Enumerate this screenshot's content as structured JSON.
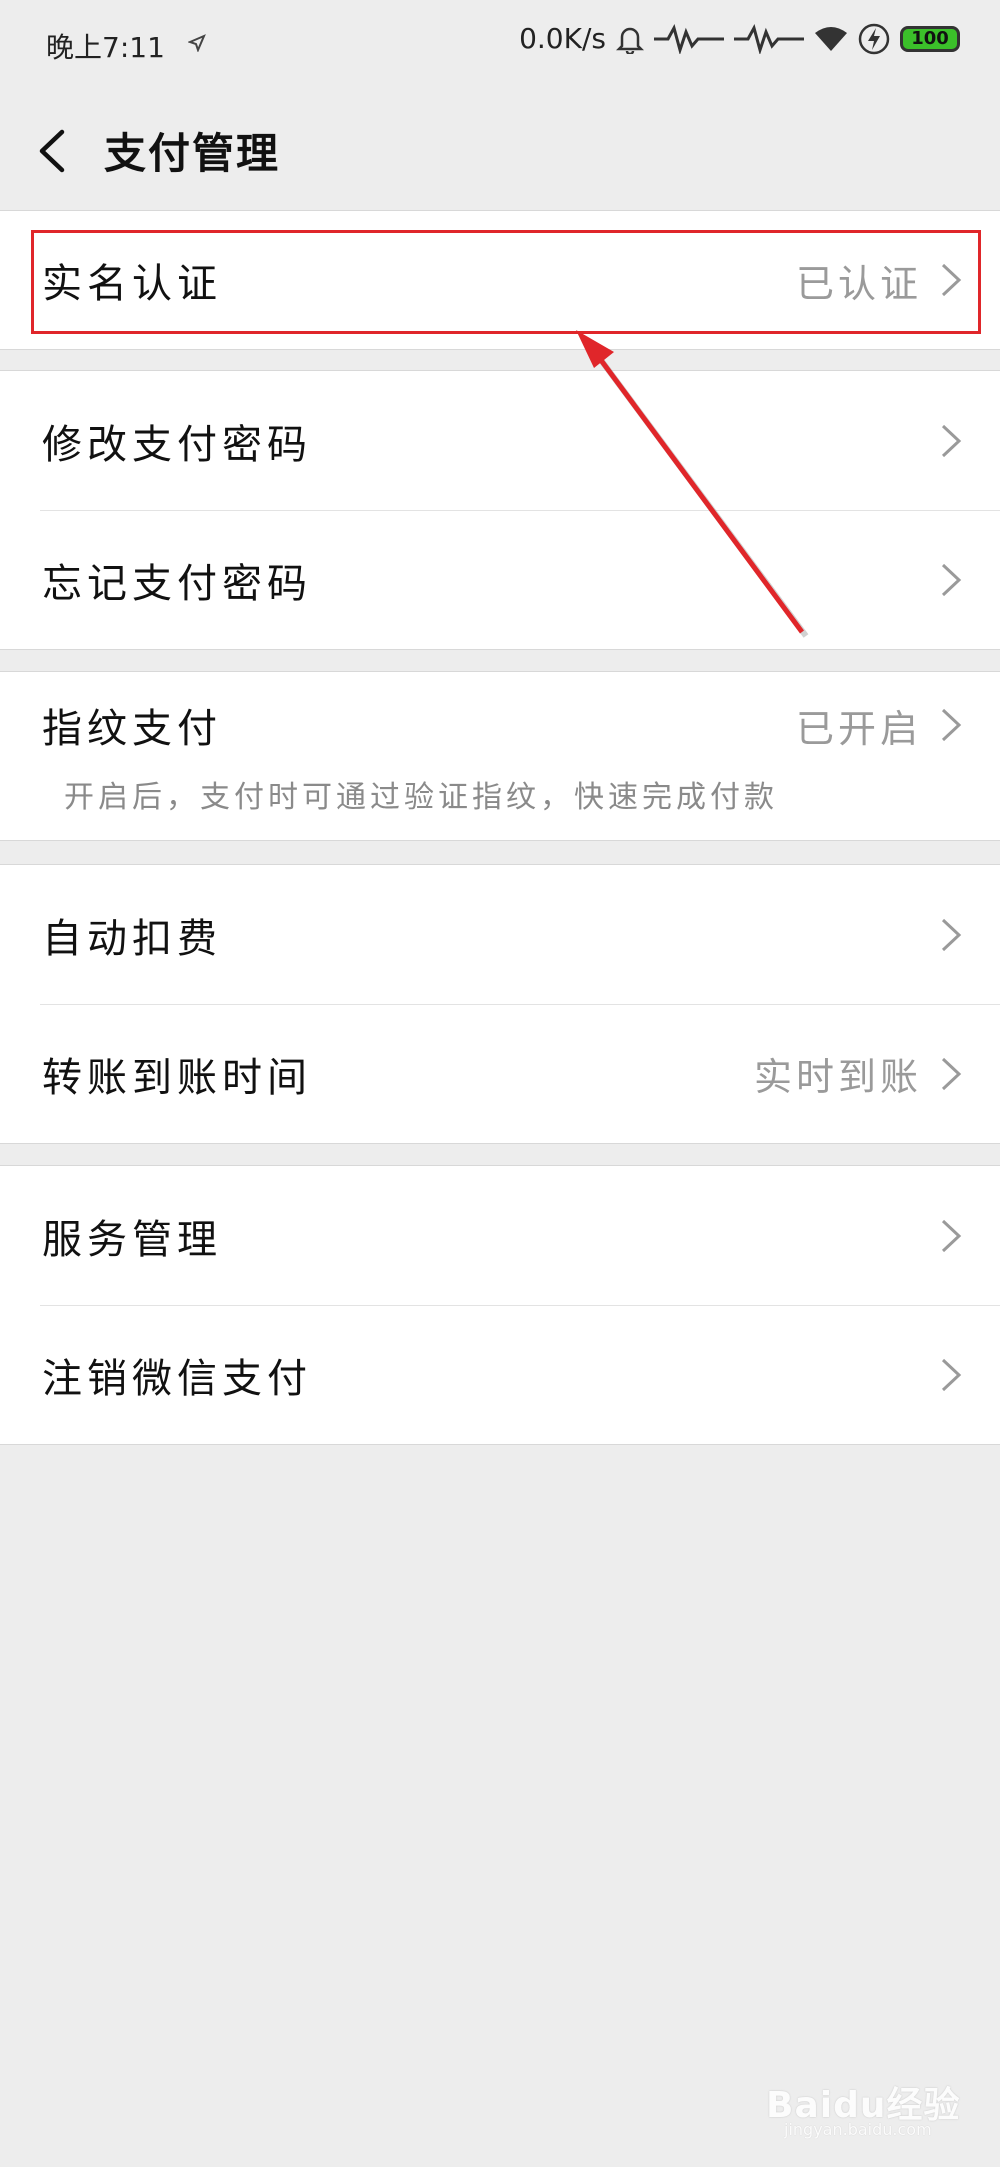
{
  "status_bar": {
    "time": "晚上7:11",
    "network_speed": "0.0K/s",
    "battery": "100"
  },
  "header": {
    "title": "支付管理"
  },
  "groups": [
    {
      "rows": [
        {
          "label": "实名认证",
          "value": "已认证"
        }
      ]
    },
    {
      "rows": [
        {
          "label": "修改支付密码",
          "value": ""
        },
        {
          "label": "忘记支付密码",
          "value": ""
        }
      ]
    },
    {
      "rows": [
        {
          "label": "指纹支付",
          "value": "已开启",
          "description": "开启后，支付时可通过验证指纹，快速完成付款"
        }
      ]
    },
    {
      "rows": [
        {
          "label": "自动扣费",
          "value": ""
        },
        {
          "label": "转账到账时间",
          "value": "实时到账"
        }
      ]
    },
    {
      "rows": [
        {
          "label": "服务管理",
          "value": ""
        },
        {
          "label": "注销微信支付",
          "value": ""
        }
      ]
    }
  ],
  "annotation": {
    "highlight_color": "#e0262a"
  },
  "watermark": {
    "brand": "Baidu经验",
    "sub": "jingyan.baidu.com"
  }
}
